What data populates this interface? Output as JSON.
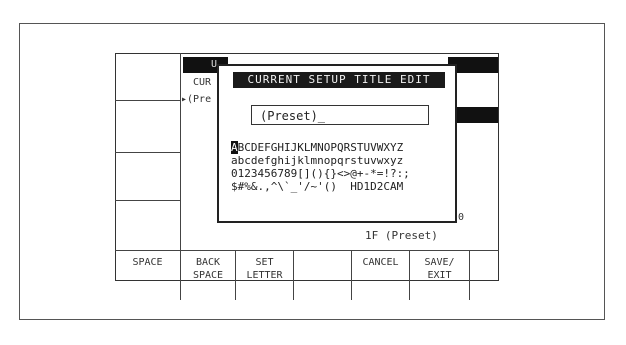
{
  "dialog": {
    "title": "CURRENT SETUP TITLE EDIT",
    "value": "(Preset)_",
    "charset": {
      "selected": "A",
      "row1_rest": "BCDEFGHIJKLMNOPQRSTUVWXYZ",
      "row2": "abcdefghijklmnopqrstuvwxyz",
      "row3": "0123456789[](){}<>@+-*=!?:;",
      "row4": "$#%&.,^\\`_'/~'()  HD1D2CAM"
    }
  },
  "background": {
    "label_v": "U",
    "label_cur": "CUR",
    "label_pre": "▸(Pre",
    "footer_value": "1F (Preset)",
    "right_digit": "0"
  },
  "softkeys": {
    "space": "SPACE",
    "back_space_1": "BACK",
    "back_space_2": "SPACE",
    "set_letter_1": "SET",
    "set_letter_2": "LETTER",
    "blank": "",
    "cancel": "CANCEL",
    "save_exit_1": "SAVE/",
    "save_exit_2": "EXIT"
  }
}
